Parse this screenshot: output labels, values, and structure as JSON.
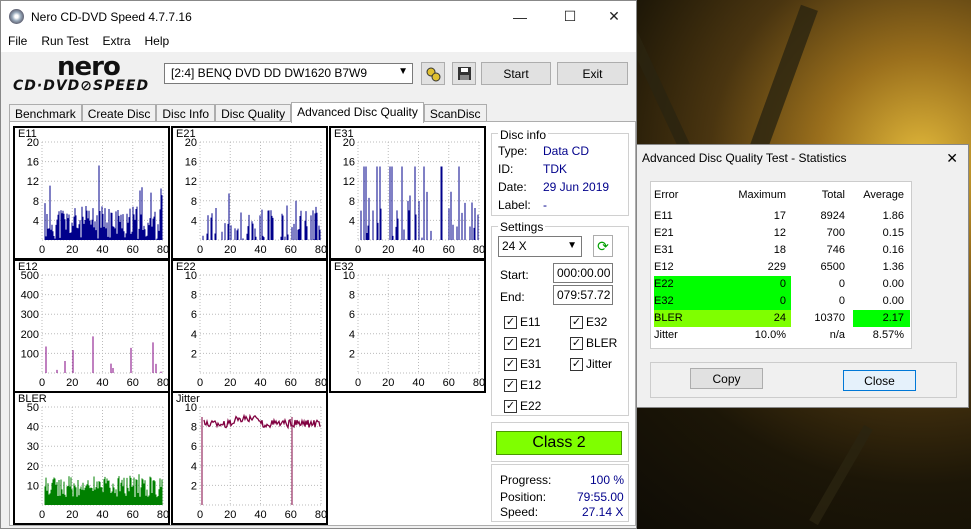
{
  "window": {
    "title": "Nero CD-DVD Speed 4.7.7.16",
    "min": "—",
    "max": "☐",
    "close": "✕"
  },
  "menu": [
    "File",
    "Run Test",
    "Extra",
    "Help"
  ],
  "logo": {
    "top": "nero",
    "bottom": "CD·DVD⊘SPEED"
  },
  "drive": {
    "selected": "[2:4]   BENQ DVD DD DW1620 B7W9"
  },
  "buttons": {
    "start": "Start",
    "exit": "Exit"
  },
  "tabs": [
    "Benchmark",
    "Create Disc",
    "Disc Info",
    "Disc Quality",
    "Advanced Disc Quality",
    "ScanDisc"
  ],
  "charts": [
    {
      "label": "E11",
      "yticks": [
        "20",
        "16",
        "12",
        "8",
        "4"
      ],
      "xticks": [
        "0",
        "20",
        "40",
        "60",
        "80"
      ],
      "color": "#00008b"
    },
    {
      "label": "E21",
      "yticks": [
        "20",
        "16",
        "12",
        "8",
        "4"
      ],
      "xticks": [
        "0",
        "20",
        "40",
        "60",
        "80"
      ],
      "color": "#00008b"
    },
    {
      "label": "E31",
      "yticks": [
        "20",
        "16",
        "12",
        "8",
        "4"
      ],
      "xticks": [
        "0",
        "20",
        "40",
        "60",
        "80"
      ],
      "color": "#00008b"
    },
    {
      "label": "E12",
      "yticks": [
        "500",
        "400",
        "300",
        "200",
        "100"
      ],
      "xticks": [
        "0",
        "20",
        "40",
        "60",
        "80"
      ],
      "color": "#800080"
    },
    {
      "label": "E22",
      "yticks": [
        "10",
        "8",
        "6",
        "4",
        "2"
      ],
      "xticks": [
        "0",
        "20",
        "40",
        "60",
        "80"
      ],
      "color": "#800080"
    },
    {
      "label": "E32",
      "yticks": [
        "10",
        "8",
        "6",
        "4",
        "2"
      ],
      "xticks": [
        "0",
        "20",
        "40",
        "60",
        "80"
      ],
      "color": "#800080"
    },
    {
      "label": "BLER",
      "yticks": [
        "50",
        "40",
        "30",
        "20",
        "10"
      ],
      "xticks": [
        "0",
        "20",
        "40",
        "60",
        "80"
      ],
      "color": "#008000"
    },
    {
      "label": "Jitter",
      "yticks": [
        "10",
        "8",
        "6",
        "4",
        "2"
      ],
      "xticks": [
        "0",
        "20",
        "40",
        "60",
        "80"
      ],
      "color": "#800040"
    }
  ],
  "disc_info": {
    "title": "Disc info",
    "type_label": "Type:",
    "type": "Data CD",
    "id_label": "ID:",
    "id": "TDK",
    "date_label": "Date:",
    "date": "29 Jun 2019",
    "label_label": "Label:",
    "label": "-"
  },
  "settings": {
    "title": "Settings",
    "speed": "24 X",
    "start_label": "Start:",
    "start": "000:00.00",
    "end_label": "End:",
    "end": "079:57.72"
  },
  "checks": [
    "E11",
    "E32",
    "E21",
    "BLER",
    "E31",
    "Jitter",
    "E12",
    "E22"
  ],
  "class_result": "Class 2",
  "progress": {
    "progress_label": "Progress:",
    "progress": "100 %",
    "position_label": "Position:",
    "position": "79:55.00",
    "speed_label": "Speed:",
    "speed": "27.14 X"
  },
  "stats": {
    "title": "Advanced Disc Quality Test - Statistics",
    "close_x": "✕",
    "headers": [
      "Error",
      "Maximum",
      "Total",
      "Average"
    ],
    "rows": [
      [
        "E11",
        "17",
        "8924",
        "1.86"
      ],
      [
        "E21",
        "12",
        "700",
        "0.15"
      ],
      [
        "E31",
        "18",
        "746",
        "0.16"
      ],
      [
        "E12",
        "229",
        "6500",
        "1.36"
      ],
      [
        "E22",
        "0",
        "0",
        "0.00"
      ],
      [
        "E32",
        "0",
        "0",
        "0.00"
      ],
      [
        "BLER",
        "24",
        "10370",
        "2.17"
      ],
      [
        "Jitter",
        "10.0%",
        "n/a",
        "8.57%"
      ]
    ],
    "copy": "Copy",
    "close": "Close"
  }
}
